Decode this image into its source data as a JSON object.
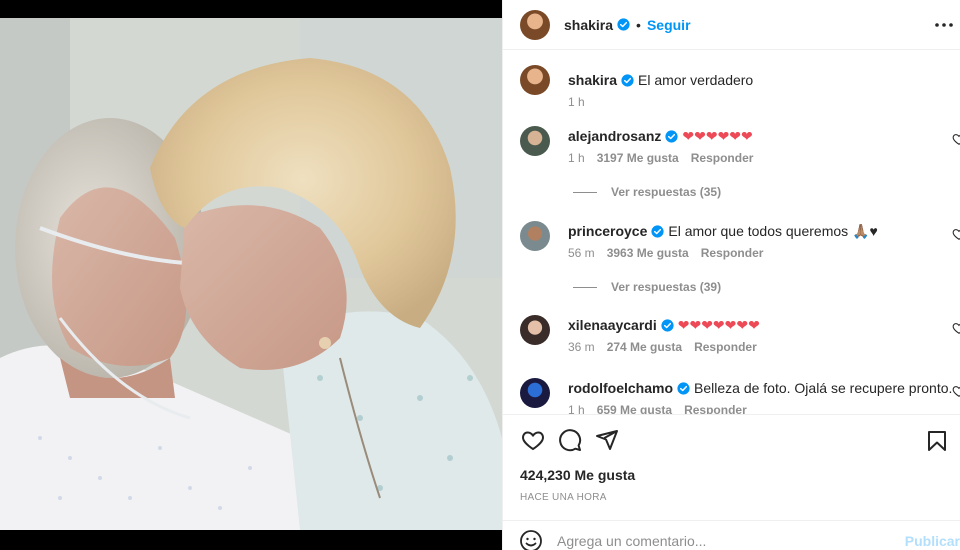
{
  "post": {
    "author": "shakira",
    "follow_label": "Seguir",
    "caption": {
      "username": "shakira",
      "text": "El amor verdadero",
      "time": "1 h"
    },
    "comments": [
      {
        "username": "alejandrosanz",
        "text": "❤❤❤❤❤❤",
        "time": "1 h",
        "likes": "3197 Me gusta",
        "reply": "Responder",
        "view_replies": "Ver respuestas (35)"
      },
      {
        "username": "princeroyce",
        "text": "El amor que todos queremos 🙏🏽♥",
        "time": "56 m",
        "likes": "3963 Me gusta",
        "reply": "Responder",
        "view_replies": "Ver respuestas (39)"
      },
      {
        "username": "xilenaaycardi",
        "text": "❤❤❤❤❤❤❤",
        "time": "36 m",
        "likes": "274 Me gusta",
        "reply": "Responder"
      },
      {
        "username": "rodolfoelchamo",
        "text": "Belleza de foto. Ojalá se recupere pronto.",
        "time": "1 h",
        "likes": "659 Me gusta",
        "reply": "Responder"
      }
    ],
    "likes_count": "424,230 Me gusta",
    "posted_ago": "HACE UNA HORA",
    "add_comment_placeholder": "Agrega un comentario...",
    "publish_label": "Publicar"
  },
  "icons": {
    "more": "more-options-icon",
    "like": "heart-icon",
    "comment": "comment-icon",
    "share": "share-icon",
    "save": "bookmark-icon",
    "emoji": "emoji-icon",
    "verified": "verified-badge-icon"
  },
  "colors": {
    "accent": "#0095f6",
    "heart_red": "#ed4956",
    "muted": "#8e8e8e",
    "publish_disabled": "#b2dffc"
  }
}
